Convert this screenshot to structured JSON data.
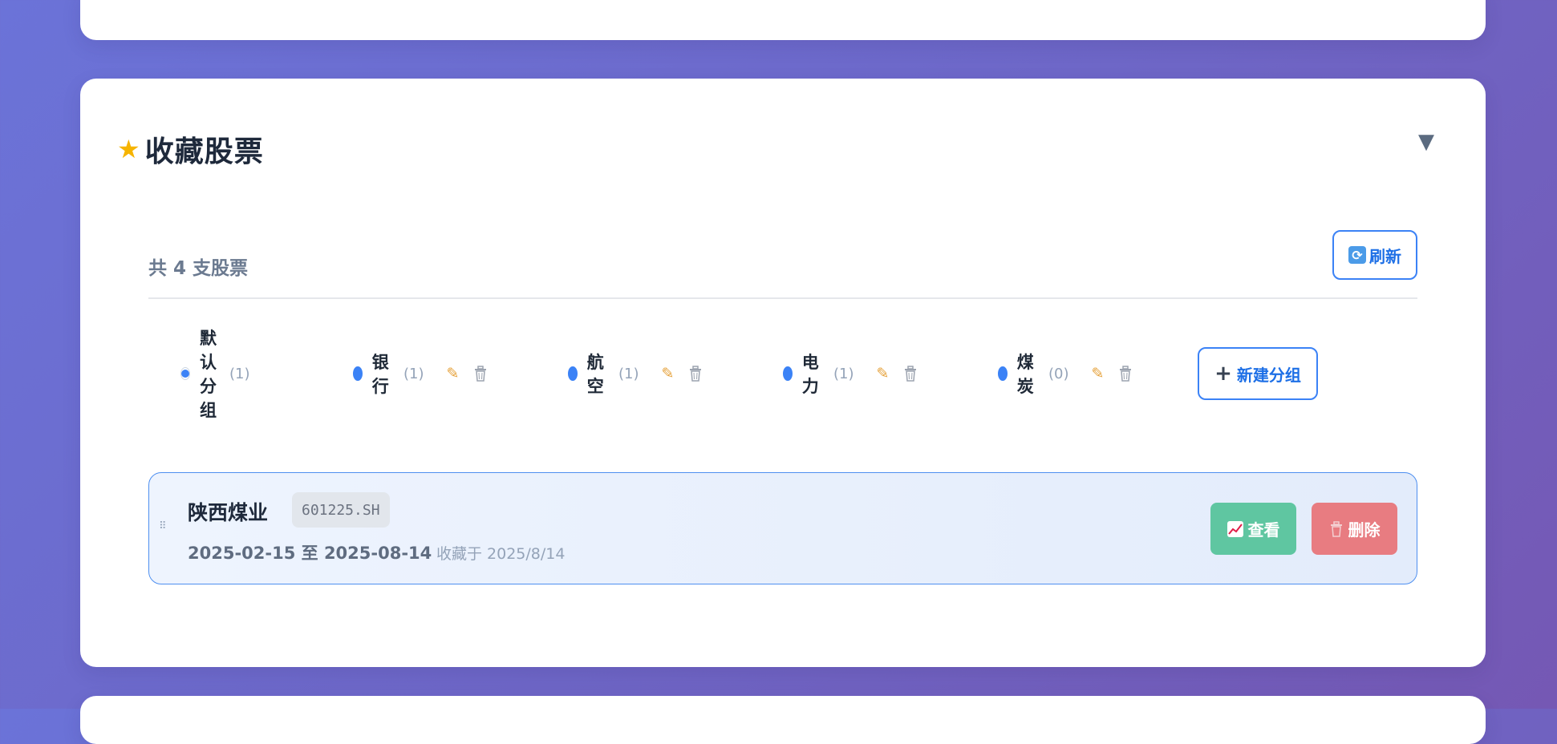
{
  "favorites": {
    "title": "收藏股票",
    "collapse_symbol": "▼",
    "summary": "共 4 支股票",
    "refresh_label": "刷新",
    "new_group_label": "新建分组",
    "groups": [
      {
        "name": "默认分组",
        "count": "(1)",
        "selected": true
      },
      {
        "name": "银行",
        "count": "(1)",
        "color": "#3b82f6"
      },
      {
        "name": "航空",
        "count": "(1)",
        "color": "#3b82f6"
      },
      {
        "name": "电力",
        "count": "(1)",
        "color": "#3b82f6"
      },
      {
        "name": "煤炭",
        "count": "(0)",
        "color": "#3b82f6"
      }
    ],
    "stocks": [
      {
        "name": "陕西煤业",
        "code": "601225.SH",
        "date_range": "2025-02-15 至 2025-08-14",
        "saved_at": "收藏于 2025/8/14",
        "view_label": "查看",
        "delete_label": "删除"
      }
    ]
  },
  "icons": {
    "title": "star-icon",
    "refresh": "refresh-icon",
    "edit": "pencil-icon",
    "delete": "trash-icon",
    "add": "plus-icon",
    "view": "chart-icon"
  },
  "colors": {
    "accent": "#3b82f6",
    "view_button": "#5fc6a1",
    "delete_button": "#e87c81",
    "star": "#f6b400"
  }
}
